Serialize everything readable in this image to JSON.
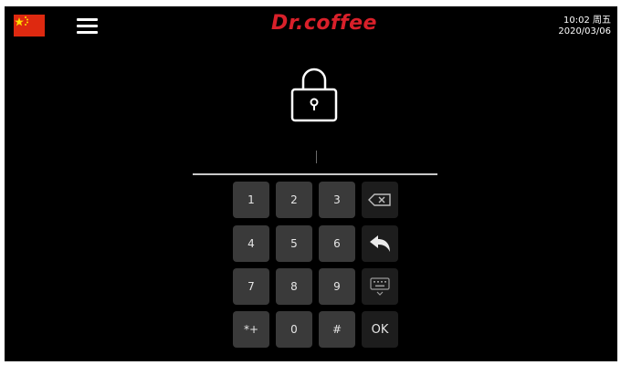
{
  "header": {
    "brand": "Dr.coffee",
    "time_line": "10:02 周五",
    "date_line": "2020/03/06",
    "icons": {
      "flag": "china-flag-icon",
      "menu": "hamburger-menu-icon",
      "lock": "padlock-icon"
    }
  },
  "pin": {
    "value": ""
  },
  "keypad": {
    "k1": "1",
    "k2": "2",
    "k3": "3",
    "k4": "4",
    "k5": "5",
    "k6": "6",
    "k7": "7",
    "k8": "8",
    "k9": "9",
    "kstar": "*+",
    "k0": "0",
    "khash": "#",
    "ok": "OK",
    "icons": {
      "backspace": "backspace-icon",
      "back": "back-arrow-icon",
      "keyboard": "keyboard-hide-icon"
    }
  },
  "colors": {
    "background": "#000000",
    "brand_red": "#d9202a",
    "key_background": "#3a3a3a",
    "key_dark_background": "#1d1d1d",
    "key_text": "#e6e6e6"
  }
}
